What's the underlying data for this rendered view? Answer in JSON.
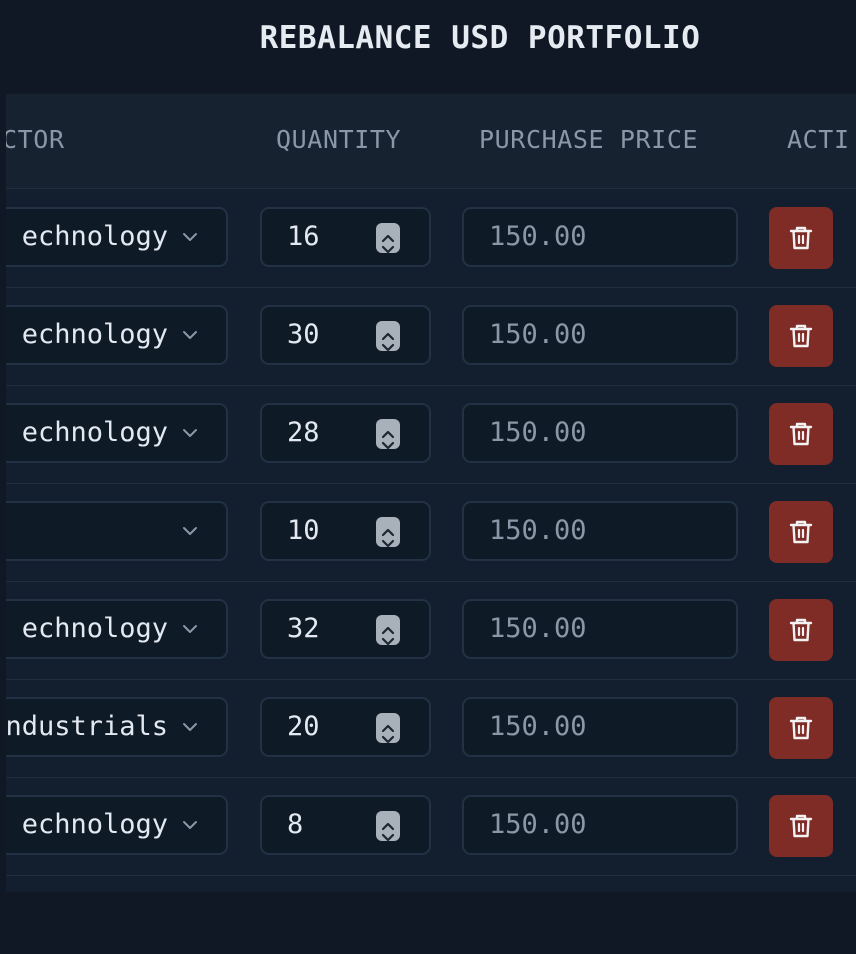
{
  "header": {
    "title": "REBALANCE USD PORTFOLIO"
  },
  "table": {
    "columns": {
      "sector": "CTOR",
      "quantity": "QUANTITY",
      "purchase_price": "PURCHASE PRICE",
      "actions": "ACTI"
    },
    "rows": [
      {
        "sector": "echnology",
        "quantity": "16",
        "purchase_price": "150.00"
      },
      {
        "sector": "echnology",
        "quantity": "30",
        "purchase_price": "150.00"
      },
      {
        "sector": "echnology",
        "quantity": "28",
        "purchase_price": "150.00"
      },
      {
        "sector": "",
        "quantity": "10",
        "purchase_price": "150.00"
      },
      {
        "sector": "echnology",
        "quantity": "32",
        "purchase_price": "150.00"
      },
      {
        "sector": "ndustrials",
        "quantity": "20",
        "purchase_price": "150.00"
      },
      {
        "sector": "echnology",
        "quantity": "8",
        "purchase_price": "150.00"
      }
    ]
  },
  "icons": {
    "dropdown": "chevron-down-icon",
    "stepper": "spinner-arrows-icon",
    "delete": "trash-icon"
  },
  "colors": {
    "background": "#0f1824",
    "delete_button": "#7f2b26",
    "title_text": "#e6ebf2",
    "header_text": "#8a97a8"
  }
}
